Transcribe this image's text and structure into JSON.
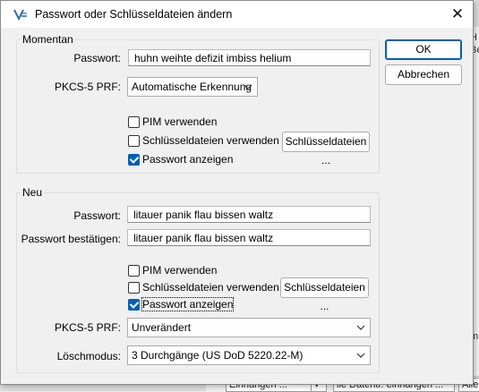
{
  "title": "Passwort oder Schlüsseldateien ändern",
  "close_glyph": "✕",
  "buttons": {
    "ok": "OK",
    "cancel": "Abbrechen"
  },
  "current": {
    "legend": "Momentan",
    "password_label": "Passwort:",
    "password_value": "huhn weihte defizit imbiss helium",
    "prf_label": "PKCS-5 PRF:",
    "prf_value": "Automatische Erkennung",
    "pim_label": "PIM verwenden",
    "pim_checked": false,
    "keyfiles_label": "Schlüsseldateien verwenden",
    "keyfiles_checked": false,
    "keyfiles_button": "Schlüsseldateien ...",
    "show_password_label": "Passwort anzeigen",
    "show_password_checked": true
  },
  "new": {
    "legend": "Neu",
    "password_label": "Passwort:",
    "password_value": "litauer panik flau bissen waltz",
    "confirm_label": "Passwort bestätigen:",
    "confirm_value": "litauer panik flau bissen waltz",
    "pim_label": "PIM verwenden",
    "pim_checked": false,
    "keyfiles_label": "Schlüsseldateien verwenden",
    "keyfiles_checked": false,
    "keyfiles_button": "Schlüsseldateien ...",
    "show_password_label": "Passwort anzeigen",
    "show_password_checked": true,
    "prf_label": "PKCS-5 PRF:",
    "prf_value": "Unverändert",
    "wipe_label": "Löschmodus:",
    "wipe_value": "3 Durchgänge (US DoD 5220.22-M)"
  },
  "background": {
    "right_texts": [
      "H",
      "Be",
      "m"
    ],
    "bottom_cells": [
      "Einhängen ...",
      "▾",
      "lle Datentr. einhängen ...",
      "Alle"
    ]
  },
  "colors": {
    "accent": "#005fb8"
  }
}
